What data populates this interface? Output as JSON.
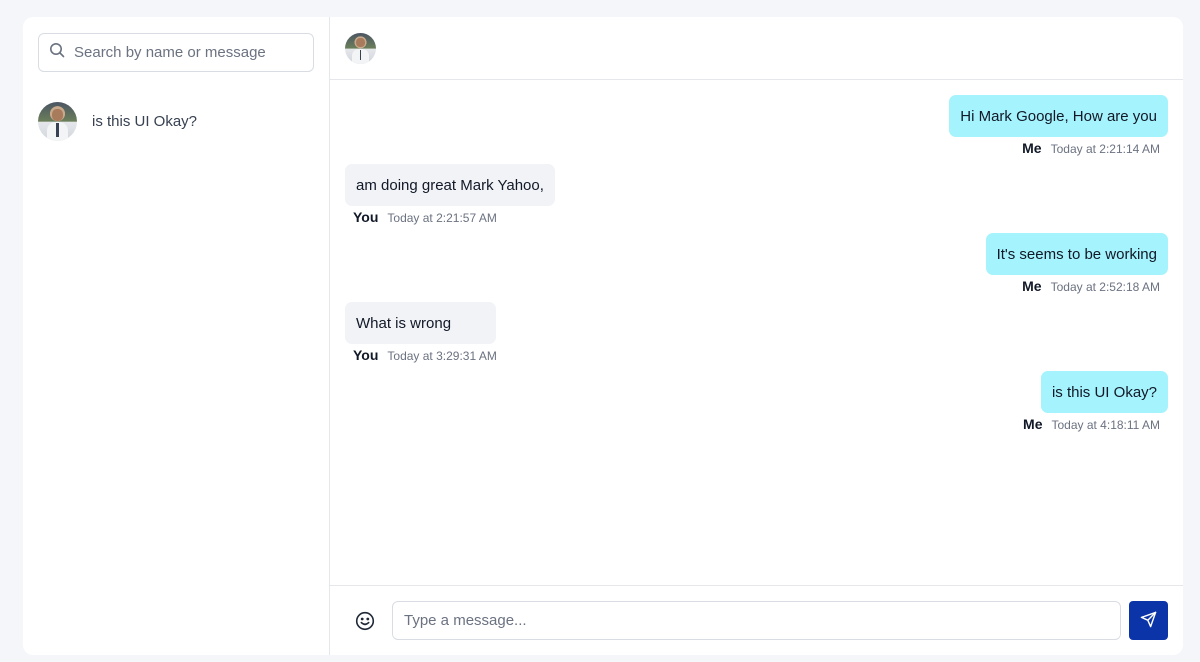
{
  "sidebar": {
    "search": {
      "placeholder": "Search by name or message",
      "icon": "search-icon"
    },
    "conversations": [
      {
        "preview": "is this UI Okay?",
        "avatar": "user-avatar"
      }
    ]
  },
  "chat": {
    "header": {
      "avatar": "contact-avatar"
    },
    "messages": [
      {
        "from": "me",
        "text": "Hi Mark Google, How are you",
        "sender": "Me",
        "time": "Today at 2:21:14 AM"
      },
      {
        "from": "you",
        "text": "am doing great Mark Yahoo,",
        "sender": "You",
        "time": "Today at 2:21:57 AM"
      },
      {
        "from": "me",
        "text": "It's seems to be working",
        "sender": "Me",
        "time": "Today at 2:52:18 AM"
      },
      {
        "from": "you",
        "text": "What is wrong",
        "sender": "You",
        "time": "Today at 3:29:31 AM"
      },
      {
        "from": "me",
        "text": "is this UI Okay?",
        "sender": "Me",
        "time": "Today at 4:18:11 AM"
      }
    ],
    "composer": {
      "placeholder": "Type a message...",
      "emoji_icon": "smiley-icon",
      "send_icon": "send-icon"
    }
  },
  "colors": {
    "me_bubble": "#a5f3fc",
    "you_bubble": "#f1f3f6",
    "send_button": "#0b34a8",
    "background": "#f4f6f9"
  }
}
